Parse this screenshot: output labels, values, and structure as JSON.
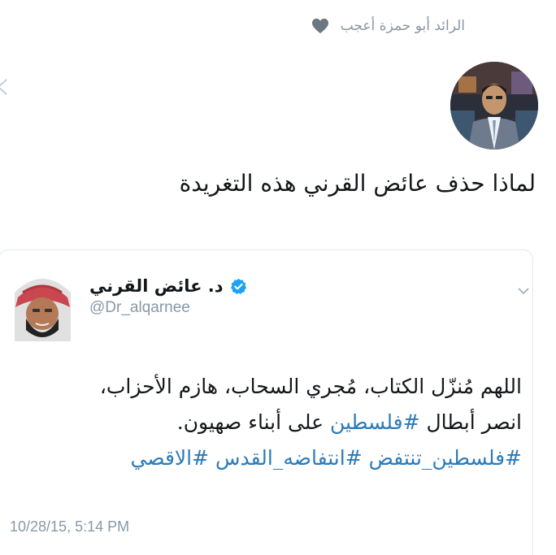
{
  "liked_by": {
    "text": "الرائد أبو حمزة أعجب",
    "icon": "heart-icon"
  },
  "tweet": {
    "text": "لماذا حذف عائض القرني هذه التغريدة",
    "avatar_icon": "user-avatar"
  },
  "quoted_tweet": {
    "author_name": "د. عائض القرني",
    "handle": "@Dr_alqarnee",
    "verified_icon": "verified-badge-icon",
    "menu_icon": "chevron-down-icon",
    "body": {
      "line1": "اللهم مُنزّل الكتاب، مُجري السحاب، هازم الأحزاب،",
      "line2_prefix": "انصر أبطال ",
      "line2_hashtag": "#فلسطين",
      "line2_suffix": " على أبناء صهيون.",
      "line3_tag1": "#فلسطين_تنتفض",
      "line3_tag2": "#انتفاضه_القدس",
      "line3_tag3": "#الاقصي"
    },
    "timestamp": "10/28/15, 5:14 PM"
  },
  "colors": {
    "link": "#2b7bb9",
    "muted": "#8899a6",
    "text": "#14171a",
    "border": "#e1e8ed"
  }
}
